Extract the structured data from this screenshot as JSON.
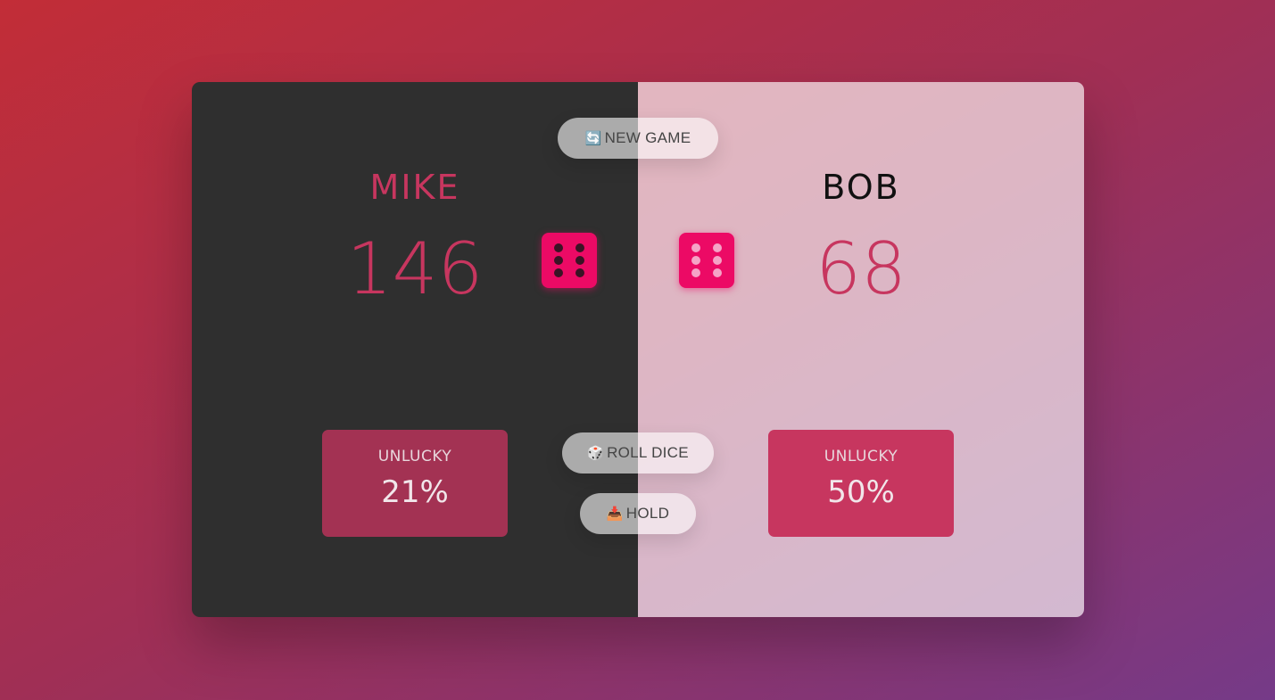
{
  "players": [
    {
      "name": "MIKE",
      "score": "146",
      "current_label": "UNLUCKY",
      "current_value": "21%"
    },
    {
      "name": "BOB",
      "score": "68",
      "current_label": "UNLUCKY",
      "current_value": "50%"
    }
  ],
  "dice": [
    {
      "face": 6,
      "icon": "dice-six-icon"
    },
    {
      "face": 6,
      "icon": "dice-six-icon"
    }
  ],
  "buttons": {
    "new_game": {
      "icon": "🔄",
      "label": "NEW GAME"
    },
    "roll_dice": {
      "icon": "🎲",
      "label": "ROLL DICE"
    },
    "hold": {
      "icon": "📥",
      "label": "HOLD"
    }
  },
  "colors": {
    "accent": "#c7365f",
    "die": "#ec0a65",
    "player1_panel": "#2f2f2f"
  }
}
